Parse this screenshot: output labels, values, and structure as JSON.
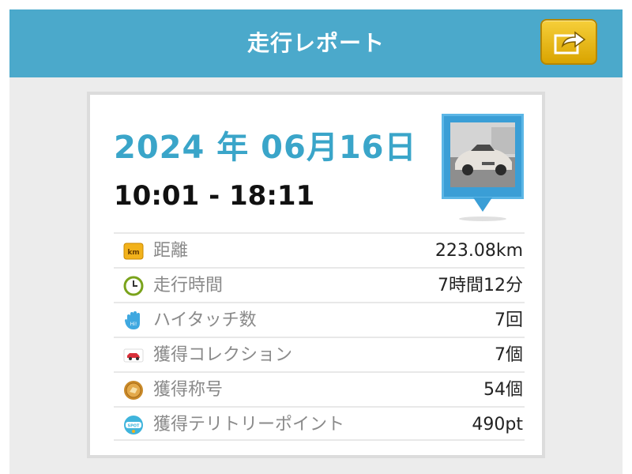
{
  "header": {
    "title": "走行レポート",
    "share_icon": "share-export-icon"
  },
  "report": {
    "date": "2024 年 06月16日",
    "time_range": "10:01 - 18:11",
    "photo_icon": "car-photo-pin-icon"
  },
  "stats": [
    {
      "label": "距離",
      "value": "223.08km",
      "icon": "km-icon"
    },
    {
      "label": "走行時間",
      "value": "7時間12分",
      "icon": "clock-icon"
    },
    {
      "label": "ハイタッチ数",
      "value": "7回",
      "icon": "hand-icon"
    },
    {
      "label": "獲得コレクション",
      "value": "7個",
      "icon": "car-icon"
    },
    {
      "label": "獲得称号",
      "value": "54個",
      "icon": "medal-icon"
    },
    {
      "label": "獲得テリトリーポイント",
      "value": "490pt",
      "icon": "spot-icon"
    }
  ],
  "colors": {
    "header_bg": "#4ba9cb",
    "date_text": "#3aa5c9",
    "share_button": "#f0c12a",
    "pin": "#3a9ed6"
  }
}
